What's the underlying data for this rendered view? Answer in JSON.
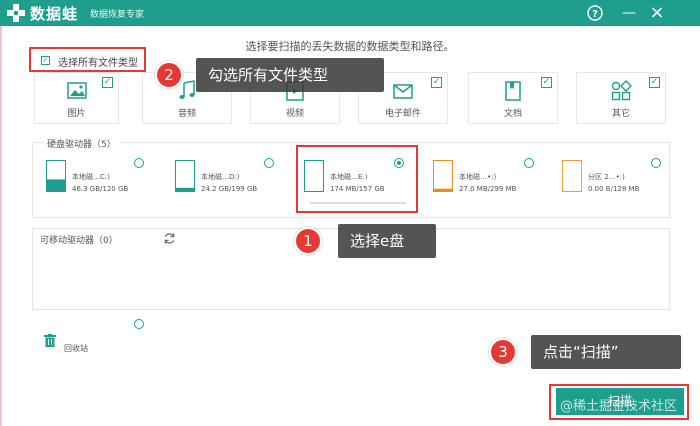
{
  "app": {
    "name": "数据蛙",
    "subtitle": "数据恢复专家",
    "brand_color": "#1f9e8d"
  },
  "window_controls": [
    {
      "name": "help-button",
      "icon": "question-circle-icon",
      "glyph": "?"
    },
    {
      "name": "minimize-button",
      "icon": "minimize-icon",
      "glyph": "—"
    },
    {
      "name": "close-button",
      "icon": "close-icon",
      "glyph": "×"
    }
  ],
  "main": {
    "instruction": "选择要扫描的丢失数据的数据类型和路径。",
    "select_all_label": "选择所有文件类型",
    "select_all_checked": true
  },
  "file_types": [
    {
      "label": "图片",
      "icon": "image-icon",
      "checked": true
    },
    {
      "label": "音频",
      "icon": "music-note-icon",
      "checked": true
    },
    {
      "label": "视频",
      "icon": "film-icon",
      "checked": true
    },
    {
      "label": "电子邮件",
      "icon": "envelope-icon",
      "checked": true
    },
    {
      "label": "文档",
      "icon": "document-icon",
      "checked": true
    },
    {
      "label": "其它",
      "icon": "shapes-icon",
      "checked": true
    }
  ],
  "hard_drives": {
    "title": "硬盘驱动器（5）",
    "items": [
      {
        "name": "本地磁…C:)",
        "size": "46.3 GB/120 GB",
        "selected": false,
        "fill": 0.39,
        "color": "#1f9e8d"
      },
      {
        "name": "本地磁…D:)",
        "size": "24.2 GB/199 GB",
        "selected": false,
        "fill": 0.12,
        "color": "#1f9e8d"
      },
      {
        "name": "本地磁…E:)",
        "size": "174 MB/157 GB",
        "selected": true,
        "fill": 0.01,
        "color": "#1f9e8d"
      },
      {
        "name": "本地磁…•:)",
        "size": "27.0 MB/299 MB",
        "selected": false,
        "fill": 0.09,
        "color": "#e8901a"
      },
      {
        "name": "分区 2…•:)",
        "size": "0.00  B/128 MB",
        "selected": false,
        "fill": 0.0,
        "color": "#e8a040"
      }
    ]
  },
  "removable": {
    "title": "可移动驱动器（0）",
    "refresh_icon": "refresh-icon"
  },
  "recycle": {
    "label": "回收站",
    "icon": "trash-icon"
  },
  "scan_button": "扫描",
  "callouts": [
    {
      "number": "1",
      "text": "选择e盘"
    },
    {
      "number": "2",
      "text": "勾选所有文件类型"
    },
    {
      "number": "3",
      "text": "点击“扫描”"
    }
  ],
  "watermark": "@稀土掘金技术社区"
}
